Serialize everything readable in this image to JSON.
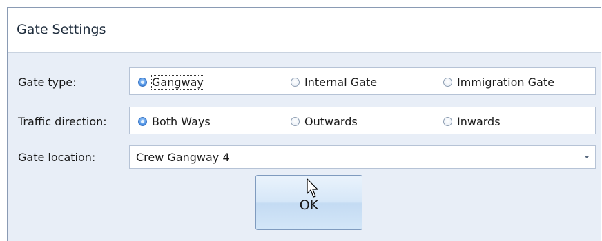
{
  "dialog": {
    "title": "Gate Settings"
  },
  "gate_type": {
    "label": "Gate type:",
    "options": [
      {
        "label": "Gangway",
        "checked": true
      },
      {
        "label": "Internal Gate",
        "checked": false
      },
      {
        "label": "Immigration Gate",
        "checked": false
      }
    ]
  },
  "traffic_direction": {
    "label": "Traffic direction:",
    "options": [
      {
        "label": "Both Ways",
        "checked": true
      },
      {
        "label": "Outwards",
        "checked": false
      },
      {
        "label": "Inwards",
        "checked": false
      }
    ]
  },
  "gate_location": {
    "label": "Gate location:",
    "value": "Crew Gangway 4"
  },
  "ok_button": {
    "label": "OK"
  },
  "icons": {
    "dropdown": "chevron-down-icon",
    "cursor": "mouse-pointer-icon"
  },
  "colors": {
    "panel_background": "#e8eef7",
    "radio_checked": "#4f93e6",
    "button_gradient_top": "#eaf3fc",
    "button_gradient_bottom": "#c4dbf3"
  }
}
